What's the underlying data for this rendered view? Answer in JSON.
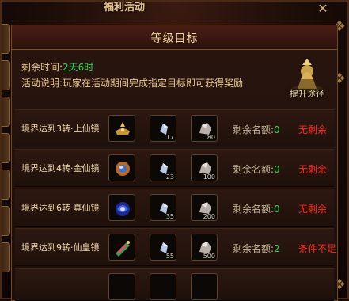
{
  "window": {
    "title": "福利活动",
    "close_glyph": "✕"
  },
  "panel": {
    "title": "等级目标",
    "remaining_label": "剩余时间:",
    "remaining_value": "2天6时",
    "desc_label": "活动说明:",
    "desc_text": "玩家在活动期间完成指定目标即可获得奖励",
    "boost_label": "提升途径"
  },
  "icons": {
    "close": "close-icon",
    "boost": "statue-icon",
    "lamp": "golden-lamp-icon",
    "orb": "orb-icon",
    "crystal": "crystal-icon",
    "ore": "ore-icon",
    "vortex": "vortex-icon",
    "scroll": "scroll-icon"
  },
  "colors": {
    "highlight_green": "#2fd84a",
    "warn_red": "#ff2a1a",
    "text_gold": "#e9c98a"
  },
  "quota_label": "剩余名额:",
  "rows": [
    {
      "label": "境界达到3转·上仙镜",
      "item1_qty": "",
      "item2_qty": "17",
      "item3_qty": "80",
      "quota": "0",
      "status": "无剩余"
    },
    {
      "label": "境界达到4转·金仙镜",
      "item1_qty": "",
      "item2_qty": "23",
      "item3_qty": "100",
      "quota": "0",
      "status": "无剩余"
    },
    {
      "label": "境界达到6转·真仙镜",
      "item1_qty": "",
      "item2_qty": "35",
      "item3_qty": "200",
      "quota": "0",
      "status": "无剩余"
    },
    {
      "label": "境界达到9转·仙皇镜",
      "item1_qty": "",
      "item2_qty": "55",
      "item3_qty": "500",
      "quota": "2",
      "status": "条件不足"
    }
  ]
}
